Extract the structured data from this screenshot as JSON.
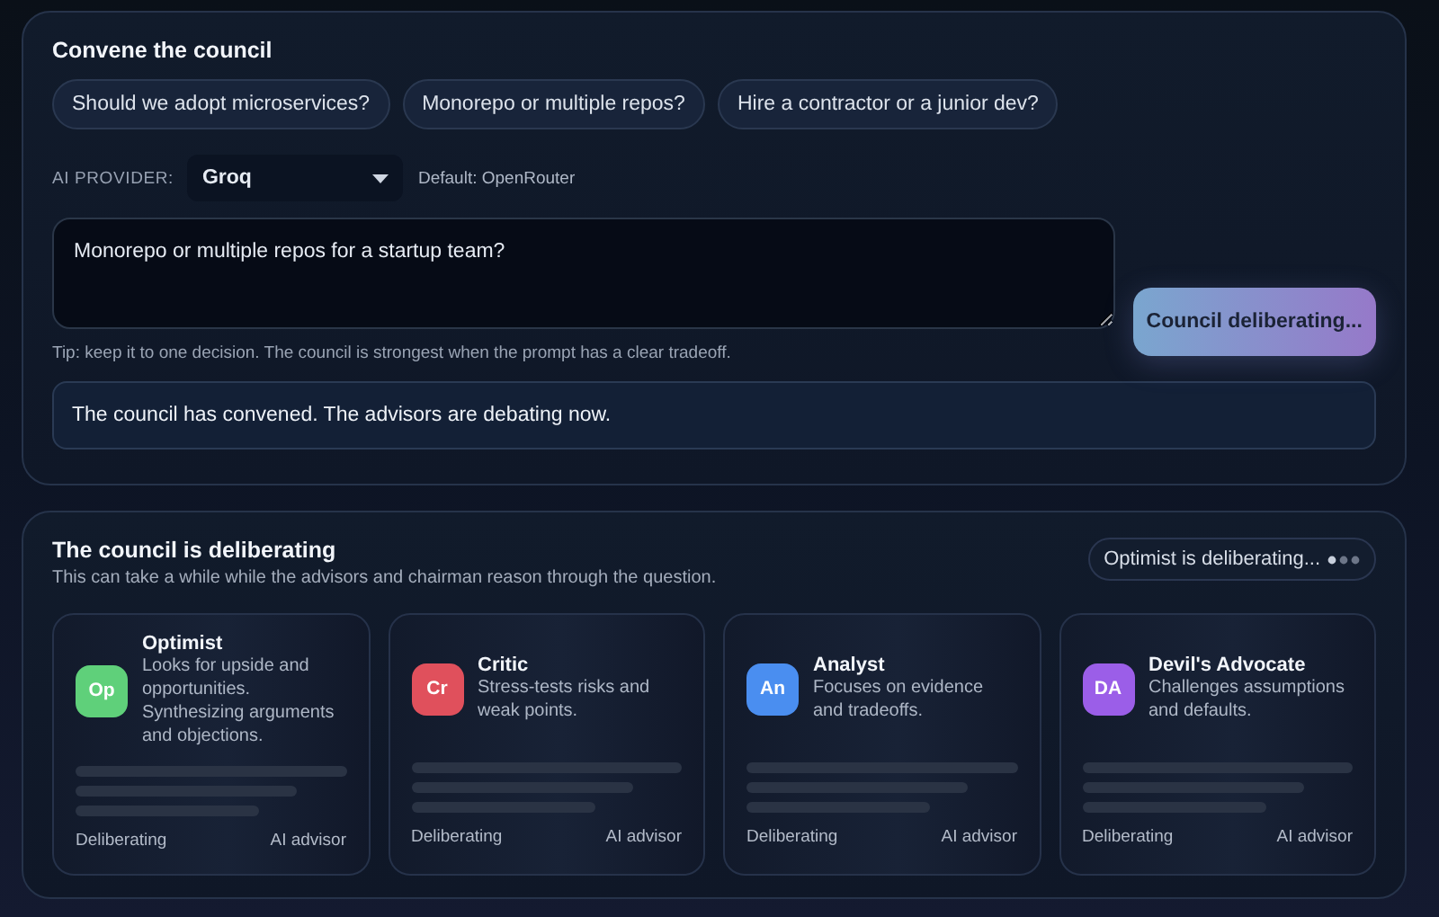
{
  "convene": {
    "title": "Convene the council",
    "suggestions": [
      "Should we adopt microservices?",
      "Monorepo or multiple repos?",
      "Hire a contractor or a junior dev?"
    ],
    "provider": {
      "label": "AI PROVIDER:",
      "value": "Groq",
      "hint": "Default: OpenRouter"
    },
    "prompt": {
      "value": "Monorepo or multiple repos for a startup team?"
    },
    "tip": "Tip: keep it to one decision. The council is strongest when the prompt has a clear tradeoff.",
    "submit": {
      "label": "Council deliberating...",
      "disabled": true
    },
    "status": "The council has convened. The advisors are debating now."
  },
  "deliberation": {
    "title": "The council is deliberating",
    "subtitle": "This can take a while while the advisors and chairman reason through the question.",
    "indicator": "Optimist is deliberating...",
    "advisors": [
      {
        "initials": "Op",
        "name": "Optimist",
        "description": "Looks for upside and opportunities.",
        "activity": "Synthesizing arguments and objections.",
        "state": "Deliberating",
        "role": "AI advisor",
        "color": "#5fd07a"
      },
      {
        "initials": "Cr",
        "name": "Critic",
        "description": "Stress-tests risks and weak points.",
        "state": "Deliberating",
        "role": "AI advisor",
        "color": "#e0505c"
      },
      {
        "initials": "An",
        "name": "Analyst",
        "description": "Focuses on evidence and tradeoffs.",
        "state": "Deliberating",
        "role": "AI advisor",
        "color": "#4a8ef0"
      },
      {
        "initials": "DA",
        "name": "Devil's Advocate",
        "description": "Challenges assumptions and defaults.",
        "state": "Deliberating",
        "role": "AI advisor",
        "color": "#9b5ee8"
      }
    ]
  }
}
